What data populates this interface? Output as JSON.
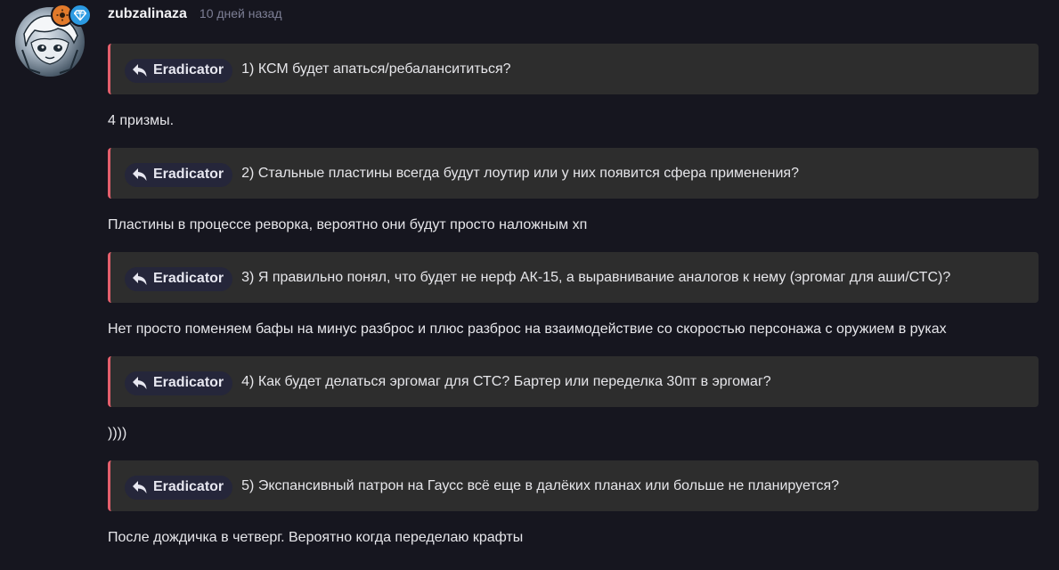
{
  "post": {
    "username": "zubzalinaza",
    "timestamp": "10 дней назад",
    "avatar_icon": "anime-character-avatar",
    "badges": [
      {
        "icon": "sun-badge-icon",
        "color": "#e27a2b"
      },
      {
        "icon": "diamond-badge-icon",
        "color": "#2b9ae2"
      }
    ],
    "accent_color": "#e45f6c",
    "items": [
      {
        "quote_author": "Eradicator",
        "quote_text": "1) КСМ будет апаться/ребалансититься?",
        "answer": "4 призмы."
      },
      {
        "quote_author": "Eradicator",
        "quote_text": "2) Стальные пластины всегда будут лоутир или у них появится сфера применения?",
        "answer": "Пластины в процессе реворка, вероятно они будут просто наложным хп"
      },
      {
        "quote_author": "Eradicator",
        "quote_text": "3) Я правильно понял, что будет не нерф АК-15, а выравнивание аналогов к нему (эргомаг для аши/СТС)?",
        "answer": "Нет просто поменяем бафы на минус разброс и плюс разброс на взаимодействие со скоростью персонажа с оружием в руках"
      },
      {
        "quote_author": "Eradicator",
        "quote_text": "4) Как будет делаться эргомаг для СТС? Бартер или переделка 30пт в эргомаг?",
        "answer": "))))"
      },
      {
        "quote_author": "Eradicator",
        "quote_text": "5) Экспансивный патрон на Гаусс всё еще в далёких планах или больше не планируется?",
        "answer": "После дождичка в четверг. Вероятно когда переделаю крафты"
      }
    ]
  }
}
